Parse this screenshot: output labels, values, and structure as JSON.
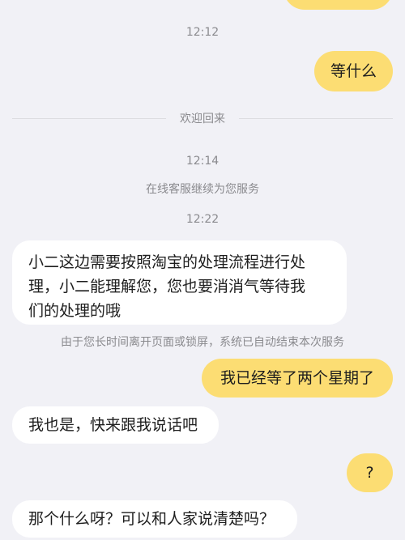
{
  "messages": {
    "m0": "",
    "t1": "12:12",
    "m1": "等什么",
    "divider": "欢迎回来",
    "t2": "12:14",
    "s1": "在线客服继续为您服务",
    "t3": "12:22",
    "m2_line1": "小二这边需要按照淘宝的处理流程进行处",
    "m2_line2": "理，小二能理解您，您也要消消气等待我",
    "m2_line3": "们的处理的哦",
    "s2": "由于您长时间离开页面或锁屏，系统已自动结束本次服务",
    "m3": "我已经等了两个星期了",
    "m4": "我也是，快来跟我说话吧",
    "m5": "?",
    "m6": "那个什么呀？可以和人家说清楚吗？"
  },
  "colors": {
    "background": "#f1f1f6",
    "my_bubble": "#fcdd73",
    "their_bubble": "#ffffff",
    "system_text": "#8a8a8e"
  }
}
